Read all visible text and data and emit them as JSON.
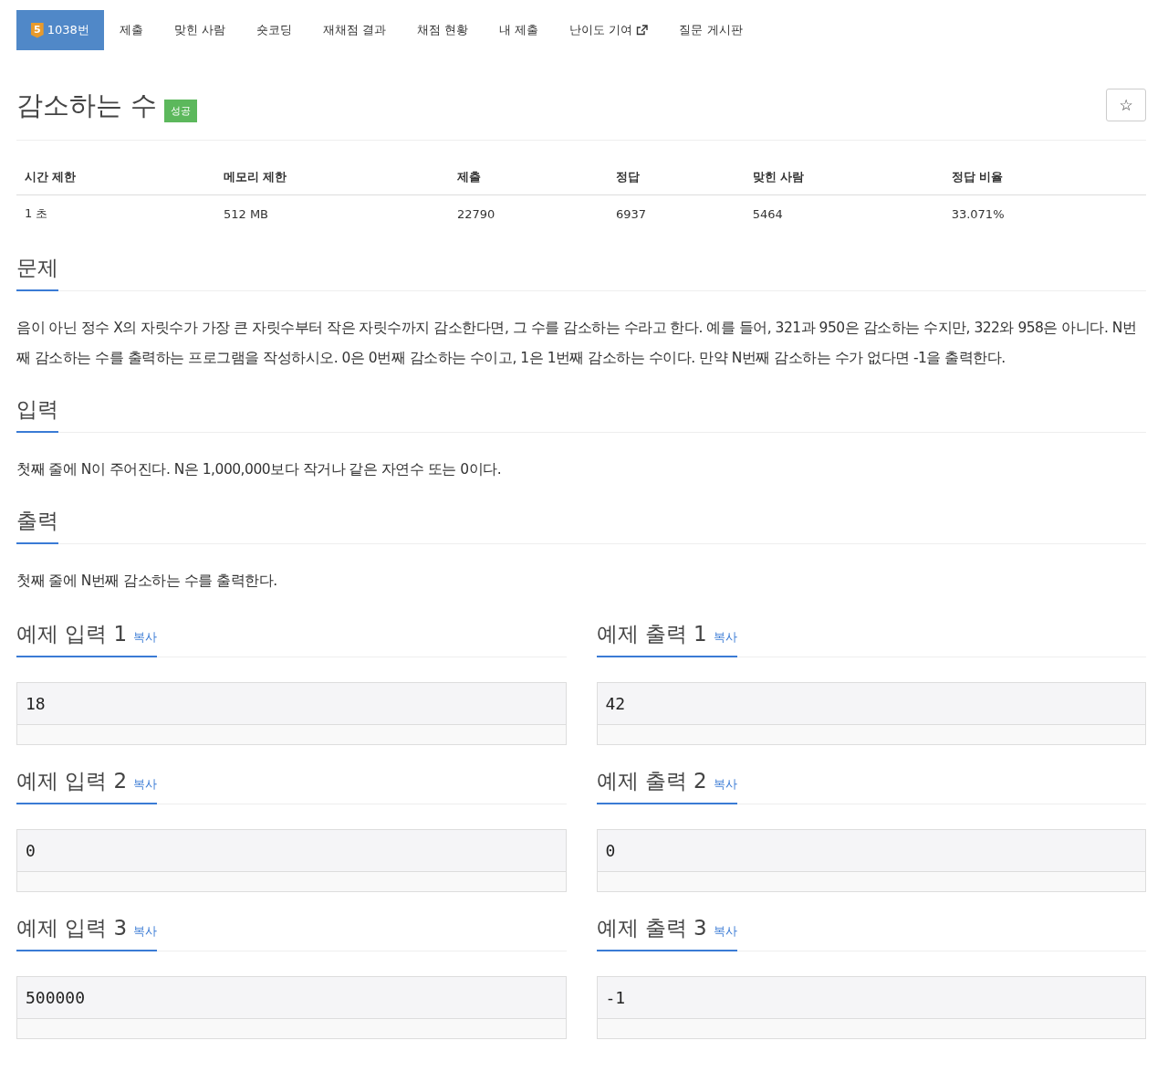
{
  "tabs": [
    {
      "label": "1038번",
      "badge": "5",
      "selected": true,
      "external": false
    },
    {
      "label": "제출",
      "selected": false,
      "external": false
    },
    {
      "label": "맞힌 사람",
      "selected": false,
      "external": false
    },
    {
      "label": "숏코딩",
      "selected": false,
      "external": false
    },
    {
      "label": "재채점 결과",
      "selected": false,
      "external": false
    },
    {
      "label": "채점 현황",
      "selected": false,
      "external": false
    },
    {
      "label": "내 제출",
      "selected": false,
      "external": false
    },
    {
      "label": "난이도 기여",
      "selected": false,
      "external": true
    },
    {
      "label": "질문 게시판",
      "selected": false,
      "external": false
    }
  ],
  "problem": {
    "title": "감소하는 수",
    "status_label": "성공",
    "star_button": "☆"
  },
  "info_table": {
    "columns": [
      "시간 제한",
      "메모리 제한",
      "제출",
      "정답",
      "맞힌 사람",
      "정답 비율"
    ],
    "rows": [
      [
        "1 초",
        "512 MB",
        "22790",
        "6937",
        "5464",
        "33.071%"
      ]
    ]
  },
  "sections": [
    {
      "heading": "문제",
      "text": "음이 아닌 정수 X의 자릿수가 가장 큰 자릿수부터 작은 자릿수까지 감소한다면, 그 수를 감소하는 수라고 한다. 예를 들어, 321과 950은 감소하는 수지만, 322와 958은 아니다. N번째 감소하는 수를 출력하는 프로그램을 작성하시오. 0은 0번째 감소하는 수이고, 1은 1번째 감소하는 수이다. 만약 N번째 감소하는 수가 없다면 -1을 출력한다."
    },
    {
      "heading": "입력",
      "text": "첫째 줄에 N이 주어진다. N은 1,000,000보다 작거나 같은 자연수 또는 0이다."
    },
    {
      "heading": "출력",
      "text": "첫째 줄에 N번째 감소하는 수를 출력한다."
    }
  ],
  "samples": [
    {
      "heading": "예제 입력 1",
      "copy": "복사",
      "value": "18"
    },
    {
      "heading": "예제 출력 1",
      "copy": "복사",
      "value": "42"
    },
    {
      "heading": "예제 입력 2",
      "copy": "복사",
      "value": "0"
    },
    {
      "heading": "예제 출력 2",
      "copy": "복사",
      "value": "0"
    },
    {
      "heading": "예제 입력 3",
      "copy": "복사",
      "value": "500000"
    },
    {
      "heading": "예제 출력 3",
      "copy": "복사",
      "value": "-1"
    }
  ]
}
